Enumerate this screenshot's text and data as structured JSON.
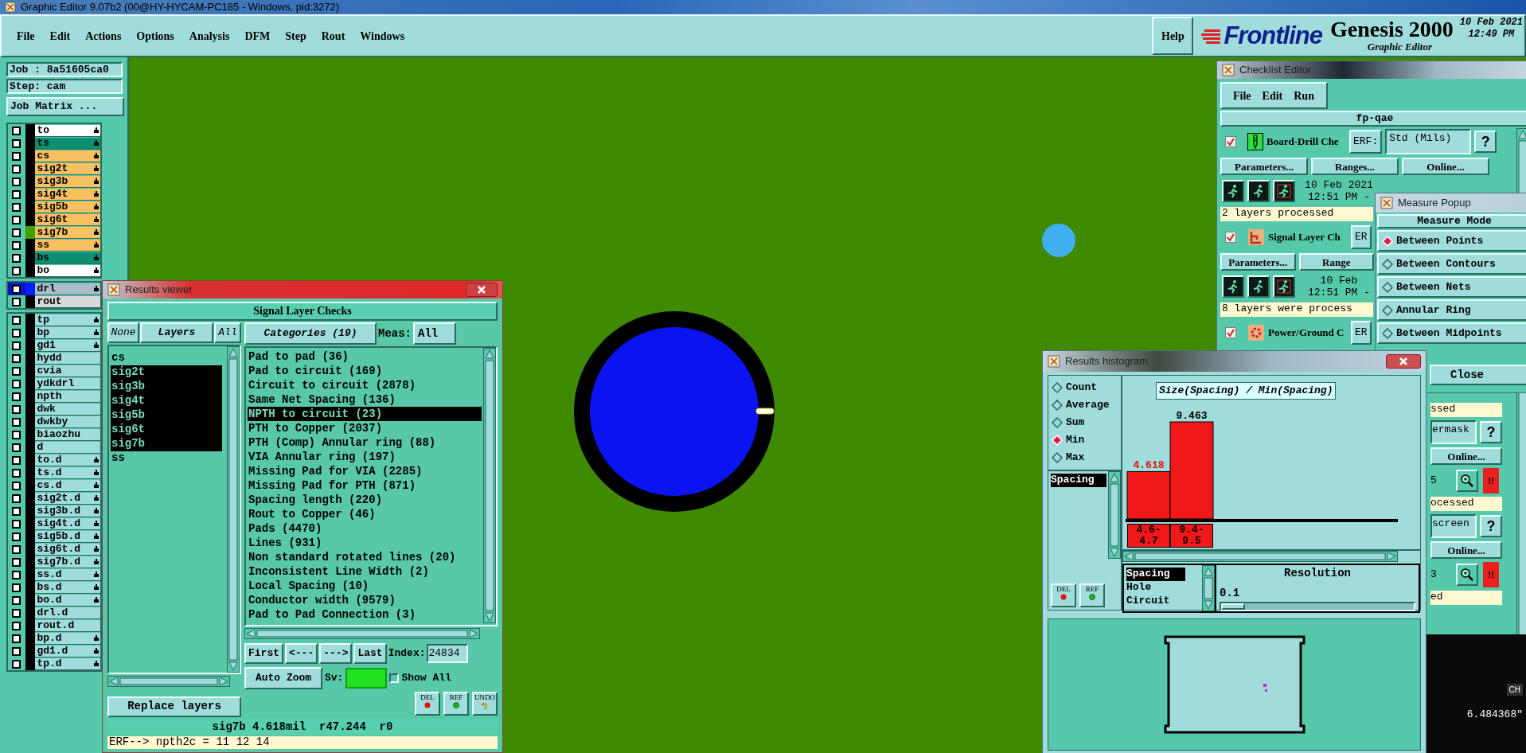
{
  "window": {
    "title": "Graphic Editor 9.07b2 (00@HY-HYCAM-PC185 - Windows, pid:3272)"
  },
  "menu": [
    "File",
    "Edit",
    "Actions",
    "Options",
    "Analysis",
    "DFM",
    "Step",
    "Rout",
    "Windows"
  ],
  "help": "Help",
  "brand": {
    "logo": "Frontline",
    "product": "Genesis 2000",
    "subtitle": "Graphic Editor",
    "date": "10 Feb 2021",
    "time": "12:49 PM"
  },
  "job_panel": {
    "job": "Job : 8a51605ca0",
    "step": "Step: cam",
    "matrix_button": "Job Matrix ...",
    "layer_groups": [
      {
        "layers": [
          {
            "name": "to",
            "kind": "silk",
            "board": true,
            "checked": false
          },
          {
            "name": "ts",
            "kind": "mask",
            "board": true,
            "checked": false
          },
          {
            "name": "cs",
            "kind": "signal",
            "board": true,
            "checked": false
          },
          {
            "name": "sig2t",
            "kind": "signal",
            "board": true,
            "checked": false
          },
          {
            "name": "sig3b",
            "kind": "signal",
            "board": true,
            "checked": false
          },
          {
            "name": "sig4t",
            "kind": "signal",
            "board": true,
            "checked": false
          },
          {
            "name": "sig5b",
            "kind": "signal",
            "board": true,
            "checked": false
          },
          {
            "name": "sig6t",
            "kind": "signal",
            "board": true,
            "checked": false
          },
          {
            "name": "sig7b",
            "kind": "signal",
            "board": true,
            "checked": false,
            "color": "#40a000"
          },
          {
            "name": "ss",
            "kind": "signal",
            "board": true,
            "checked": false
          },
          {
            "name": "bs",
            "kind": "mask",
            "board": true,
            "checked": false
          },
          {
            "name": "bo",
            "kind": "silk",
            "board": true,
            "checked": false
          }
        ]
      },
      {
        "layers": [
          {
            "name": "drl",
            "kind": "drill",
            "board": true,
            "checked": false,
            "color": "#0020ff"
          },
          {
            "name": "rout",
            "kind": "rout",
            "board": false,
            "checked": false
          }
        ]
      },
      {
        "layers": [
          {
            "name": "tp",
            "kind": "document",
            "board": true,
            "checked": false
          },
          {
            "name": "bp",
            "kind": "document",
            "board": true,
            "checked": false
          },
          {
            "name": "gd1",
            "kind": "document",
            "board": true,
            "checked": false
          },
          {
            "name": "hydd",
            "kind": "document",
            "board": false,
            "checked": false
          },
          {
            "name": "cvia",
            "kind": "document",
            "board": false,
            "checked": false
          },
          {
            "name": "ydkdrl",
            "kind": "document",
            "board": false,
            "checked": false
          },
          {
            "name": "npth",
            "kind": "document",
            "board": false,
            "checked": false
          },
          {
            "name": "dwk",
            "kind": "document",
            "board": false,
            "checked": false
          },
          {
            "name": "dwkby",
            "kind": "document",
            "board": false,
            "checked": false
          },
          {
            "name": "biaozhu",
            "kind": "document",
            "board": false,
            "checked": false
          },
          {
            "name": "d",
            "kind": "document",
            "board": false,
            "checked": false
          },
          {
            "name": "to.d",
            "kind": "document",
            "board": true,
            "checked": false
          },
          {
            "name": "ts.d",
            "kind": "document",
            "board": true,
            "checked": false
          },
          {
            "name": "cs.d",
            "kind": "document",
            "board": true,
            "checked": false
          },
          {
            "name": "sig2t.d",
            "kind": "document",
            "board": true,
            "checked": false
          },
          {
            "name": "sig3b.d",
            "kind": "document",
            "board": true,
            "checked": false
          },
          {
            "name": "sig4t.d",
            "kind": "document",
            "board": true,
            "checked": false
          },
          {
            "name": "sig5b.d",
            "kind": "document",
            "board": true,
            "checked": false
          },
          {
            "name": "sig6t.d",
            "kind": "document",
            "board": true,
            "checked": false
          },
          {
            "name": "sig7b.d",
            "kind": "document",
            "board": true,
            "checked": false
          },
          {
            "name": "ss.d",
            "kind": "document",
            "board": true,
            "checked": false
          },
          {
            "name": "bs.d",
            "kind": "document",
            "board": true,
            "checked": false
          },
          {
            "name": "bo.d",
            "kind": "document",
            "board": true,
            "checked": false
          },
          {
            "name": "drl.d",
            "kind": "document",
            "board": false,
            "checked": false
          },
          {
            "name": "rout.d",
            "kind": "document",
            "board": false,
            "checked": false
          },
          {
            "name": "bp.d",
            "kind": "document",
            "board": true,
            "checked": false
          },
          {
            "name": "gd1.d",
            "kind": "document",
            "board": true,
            "checked": false
          },
          {
            "name": "tp.d",
            "kind": "document",
            "board": true,
            "checked": false
          }
        ]
      }
    ]
  },
  "results_viewer": {
    "title": "Results viewer",
    "heading": "Signal Layer Checks",
    "none_button": "None",
    "layers_button": "Layers",
    "all_button": "All",
    "layers": [
      {
        "name": "cs",
        "selected": false
      },
      {
        "name": "sig2t",
        "selected": true
      },
      {
        "name": "sig3b",
        "selected": true
      },
      {
        "name": "sig4t",
        "selected": true
      },
      {
        "name": "sig5b",
        "selected": true
      },
      {
        "name": "sig6t",
        "selected": true
      },
      {
        "name": "sig7b",
        "selected": true
      },
      {
        "name": "ss",
        "selected": false
      }
    ],
    "replace_button": "Replace layers",
    "categories_button": "Categories (19)",
    "meas_label": "Meas:",
    "meas_value": "All",
    "categories": [
      {
        "label": "Pad to pad (36)",
        "selected": false
      },
      {
        "label": "Pad to circuit (169)",
        "selected": false
      },
      {
        "label": "Circuit to circuit (2878)",
        "selected": false
      },
      {
        "label": "Same Net Spacing (136)",
        "selected": false
      },
      {
        "label": "NPTH to circuit (23)",
        "selected": true
      },
      {
        "label": "PTH to Copper (2037)",
        "selected": false
      },
      {
        "label": "PTH (Comp) Annular ring (88)",
        "selected": false
      },
      {
        "label": "VIA Annular ring (197)",
        "selected": false
      },
      {
        "label": "Missing Pad for VIA (2285)",
        "selected": false
      },
      {
        "label": "Missing Pad for PTH (871)",
        "selected": false
      },
      {
        "label": "Spacing length (220)",
        "selected": false
      },
      {
        "label": "Rout to Copper (46)",
        "selected": false
      },
      {
        "label": "Pads (4470)",
        "selected": false
      },
      {
        "label": "Lines (931)",
        "selected": false
      },
      {
        "label": "Non standard rotated lines (20)",
        "selected": false
      },
      {
        "label": "Inconsistent Line Width (2)",
        "selected": false
      },
      {
        "label": "Local Spacing (10)",
        "selected": false
      },
      {
        "label": "Conductor width (9579)",
        "selected": false
      },
      {
        "label": "Pad to Pad Connection (3)",
        "selected": false
      }
    ],
    "nav_buttons": [
      "First",
      "<---",
      "--->",
      "Last"
    ],
    "index_label": "Index:",
    "index_value": "24834",
    "zoom_mode": "Auto Zoom",
    "sv_label": "Sv:",
    "show_all": {
      "label": "Show All",
      "checked": false
    },
    "tool_buttons": [
      {
        "label": "DEL",
        "kind": "delete"
      },
      {
        "label": "REF",
        "kind": "refresh"
      },
      {
        "label": "UNDO",
        "kind": "undo"
      }
    ],
    "status": "sig7b 4.618mil  r47.244  r0",
    "erf_line": "ERF--> npth2c = 11 12 14"
  },
  "histogram": {
    "title": "Results histogram",
    "modes": [
      {
        "label": "Count",
        "selected": false
      },
      {
        "label": "Average",
        "selected": false
      },
      {
        "label": "Sum",
        "selected": false
      },
      {
        "label": "Min",
        "selected": true
      },
      {
        "label": "Max",
        "selected": false
      }
    ],
    "measures": [
      {
        "label": "Spacing",
        "selected": true
      }
    ],
    "tool_buttons": [
      {
        "label": "DEL",
        "kind": "delete"
      },
      {
        "label": "REF",
        "kind": "refresh"
      }
    ],
    "chart_data": {
      "type": "bar",
      "title": "Size(Spacing) / Min(Spacing)",
      "categories": [
        "4.6-4.7",
        "9.4-9.5"
      ],
      "values": [
        4.618,
        9.463
      ],
      "data_labels": true
    },
    "sources": [
      {
        "label": "Spacing",
        "selected": true
      },
      {
        "label": "Hole",
        "selected": false
      },
      {
        "label": "Circuit",
        "selected": false
      }
    ],
    "resolution": {
      "label": "Resolution",
      "value": "0.1",
      "level": 0
    }
  },
  "checklist_editor": {
    "title": "Checklist Editor",
    "menu": [
      "File",
      "Edit",
      "Run"
    ],
    "checklist_name": "fp-qae",
    "checks": [
      {
        "name": "Board-Drill Che",
        "kind": "drill",
        "checked": true,
        "erf": "ERF:",
        "erf_value": "Std (Mils)",
        "help": "?",
        "buttons": [
          "Parameters...",
          "Ranges...",
          "Online..."
        ],
        "date": "10 Feb 2021",
        "time": "12:51 PM -",
        "result": "2 layers processed"
      },
      {
        "name": "Signal Layer Ch",
        "kind": "signal",
        "checked": true,
        "erf": "ER",
        "buttons": [
          "Parameters...",
          "Range"
        ],
        "date": "10 Feb",
        "time": "12:51 PM -",
        "result": "8 layers were process"
      },
      {
        "name": "Power/Ground C",
        "kind": "power",
        "checked": true,
        "erf": "ER"
      }
    ],
    "partial_rows": [
      {
        "kind": "result",
        "text": "ssed"
      },
      {
        "kind": "field",
        "text": "ermask",
        "help": "?"
      },
      {
        "kind": "button",
        "text": "Online..."
      },
      {
        "kind": "status",
        "text": "5",
        "alert": "!!"
      },
      {
        "kind": "result",
        "text": "ocessed"
      },
      {
        "kind": "field",
        "text": "screen",
        "help": "?"
      },
      {
        "kind": "button",
        "text": "Online..."
      },
      {
        "kind": "status",
        "text": "3",
        "alert": "!!"
      },
      {
        "kind": "result",
        "text": "ed"
      }
    ]
  },
  "measure_popup": {
    "title": "Measure Popup",
    "heading": "Measure Mode",
    "modes": [
      {
        "label": "Between Points",
        "selected": true
      },
      {
        "label": "Between Contours",
        "selected": false
      },
      {
        "label": "Between Nets",
        "selected": false
      },
      {
        "label": "Annular Ring",
        "selected": false
      },
      {
        "label": "Between Midpoints",
        "selected": false
      }
    ],
    "close_button": "Close"
  },
  "status_readout": {
    "badge": "CH",
    "coordinate": "6.484368\""
  }
}
